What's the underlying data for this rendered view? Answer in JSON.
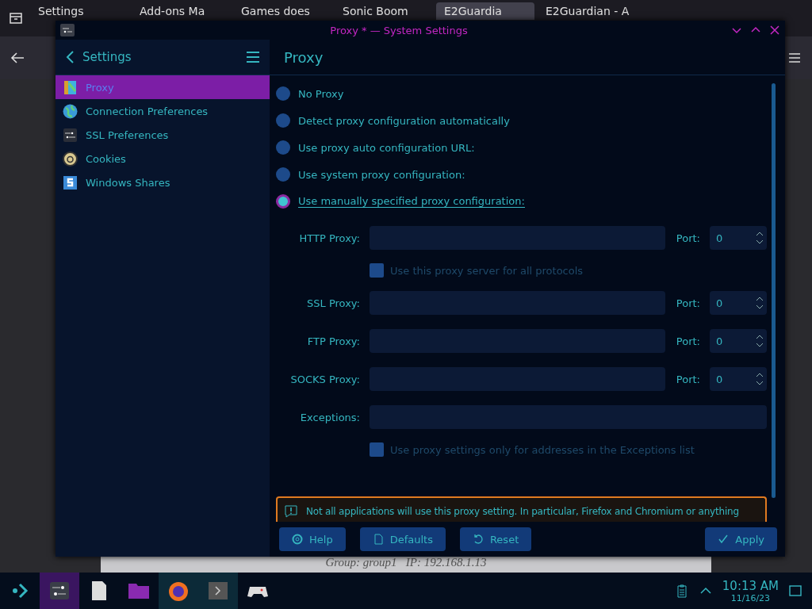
{
  "browser": {
    "tabs": [
      {
        "label": "Settings",
        "selected": false
      },
      {
        "label": "Add-ons Ma",
        "selected": false
      },
      {
        "label": "Games does",
        "selected": false
      },
      {
        "label": "Sonic Boom",
        "selected": false
      },
      {
        "label": "E2Guardia",
        "selected": true
      },
      {
        "label": "E2Guardian - A",
        "selected": false
      }
    ],
    "page_text": "Group: group1   IP: 192.168.1.13"
  },
  "window": {
    "title": "Proxy * — System Settings"
  },
  "sidebar": {
    "back_label": "Settings",
    "items": [
      {
        "label": "Proxy",
        "selected": true
      },
      {
        "label": "Connection Preferences",
        "selected": false
      },
      {
        "label": "SSL Preferences",
        "selected": false
      },
      {
        "label": "Cookies",
        "selected": false
      },
      {
        "label": "Windows Shares",
        "selected": false
      }
    ]
  },
  "page": {
    "title": "Proxy",
    "options": [
      {
        "label": "No Proxy",
        "selected": false
      },
      {
        "label": "Detect proxy configuration automatically",
        "selected": false
      },
      {
        "label": "Use proxy auto configuration URL:",
        "selected": false
      },
      {
        "label": "Use system proxy configuration:",
        "selected": false
      },
      {
        "label": "Use manually specified proxy configuration:",
        "selected": true
      }
    ],
    "proxies": [
      {
        "label": "HTTP Proxy:",
        "port_label": "Port:",
        "port": "0"
      },
      {
        "label": "SSL Proxy:",
        "port_label": "Port:",
        "port": "0"
      },
      {
        "label": "FTP Proxy:",
        "port_label": "Port:",
        "port": "0"
      },
      {
        "label": "SOCKS Proxy:",
        "port_label": "Port:",
        "port": "0"
      }
    ],
    "all_protocols": {
      "label": "Use this proxy server for all protocols",
      "checked": false,
      "disabled": true
    },
    "exceptions_label": "Exceptions:",
    "only_exceptions": {
      "label": "Use proxy settings only for addresses in the Exceptions list",
      "checked": false,
      "disabled": true
    },
    "warning": "Not all applications will use this proxy setting. In particular, Firefox and Chromium or anything"
  },
  "buttons": [
    {
      "label": "Help",
      "kind": "help"
    },
    {
      "label": "Defaults",
      "kind": "defaults"
    },
    {
      "label": "Reset",
      "kind": "reset"
    },
    {
      "label": "Apply",
      "kind": "apply"
    }
  ],
  "taskbar": {
    "time": "10:13 AM",
    "date": "11/16/23"
  }
}
